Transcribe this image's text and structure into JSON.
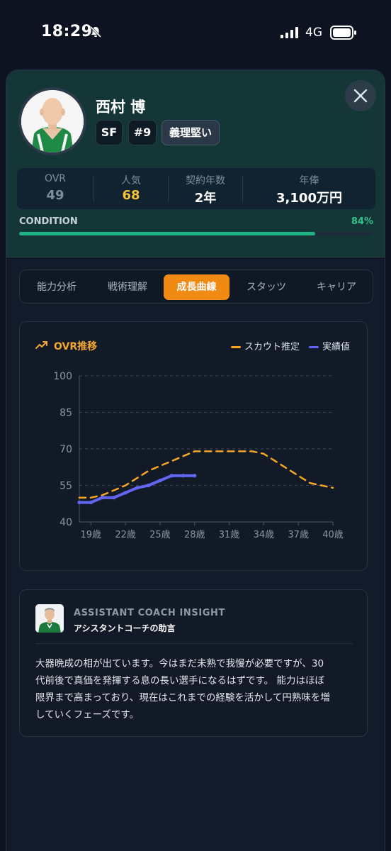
{
  "status_bar": {
    "time": "18:29",
    "network": "4G"
  },
  "player": {
    "name": "西村 博",
    "position": "SF",
    "number": "#9",
    "trait": "義理堅い"
  },
  "stats": [
    {
      "label": "OVR",
      "value": "49",
      "color": "#7e8ea0"
    },
    {
      "label": "人気",
      "value": "68",
      "color": "#f5c23a"
    },
    {
      "label": "契約年数",
      "value": "2年",
      "color": "#ffffff"
    },
    {
      "label": "年俸",
      "value": "3,100万円",
      "color": "#ffffff"
    }
  ],
  "condition": {
    "label": "CONDITION",
    "percent_text": "84%",
    "value": 0.84
  },
  "tabs": [
    {
      "label": "能力分析",
      "active": false
    },
    {
      "label": "戦術理解",
      "active": false
    },
    {
      "label": "成長曲線",
      "active": true
    },
    {
      "label": "スタッツ",
      "active": false
    },
    {
      "label": "キャリア",
      "active": false
    }
  ],
  "chart_header": {
    "title": "OVR推移",
    "icon": "trending-up-icon"
  },
  "chart_data": {
    "type": "line",
    "title": "OVR推移",
    "xlabel": "",
    "ylabel": "",
    "x_ticks": [
      "19歳",
      "22歳",
      "25歳",
      "28歳",
      "31歳",
      "34歳",
      "37歳",
      "40歳"
    ],
    "x_range": [
      18,
      40
    ],
    "y_ticks": [
      100,
      85,
      70,
      55,
      40
    ],
    "ylim": [
      40,
      100
    ],
    "grid": true,
    "legend": "top-right",
    "series": [
      {
        "name": "スカウト推定",
        "style": "dashed",
        "color": "#f5a623",
        "points": [
          [
            18,
            50
          ],
          [
            19,
            50
          ],
          [
            20,
            51
          ],
          [
            21,
            53
          ],
          [
            22,
            55
          ],
          [
            23,
            58
          ],
          [
            24,
            61
          ],
          [
            25,
            63
          ],
          [
            26,
            65
          ],
          [
            27,
            67
          ],
          [
            28,
            69
          ],
          [
            29,
            69
          ],
          [
            30,
            69
          ],
          [
            31,
            69
          ],
          [
            32,
            69
          ],
          [
            33,
            69
          ],
          [
            34,
            68
          ],
          [
            35,
            65
          ],
          [
            36,
            62
          ],
          [
            37,
            59
          ],
          [
            38,
            56
          ],
          [
            39,
            55
          ],
          [
            40,
            54
          ]
        ]
      },
      {
        "name": "実績値",
        "style": "solid",
        "color": "#6366f1",
        "points": [
          [
            18,
            48
          ],
          [
            19,
            48
          ],
          [
            20,
            50
          ],
          [
            21,
            50
          ],
          [
            22,
            52
          ],
          [
            23,
            54
          ],
          [
            24,
            55
          ],
          [
            25,
            57
          ],
          [
            26,
            59
          ],
          [
            27,
            59
          ],
          [
            28,
            59
          ]
        ]
      }
    ]
  },
  "coach": {
    "title": "ASSISTANT COACH INSIGHT",
    "subtitle": "アシスタントコーチの助言",
    "lines": [
      "大器晩成の相が出ています。今はまだ未熟で我慢が必要ですが、30",
      "代前後で真価を発揮する息の長い選手になるはずです。 能力はほぼ",
      "限界まで高まっており、現在はこれまでの経験を活かして円熟味を増",
      "していくフェーズです。"
    ]
  }
}
